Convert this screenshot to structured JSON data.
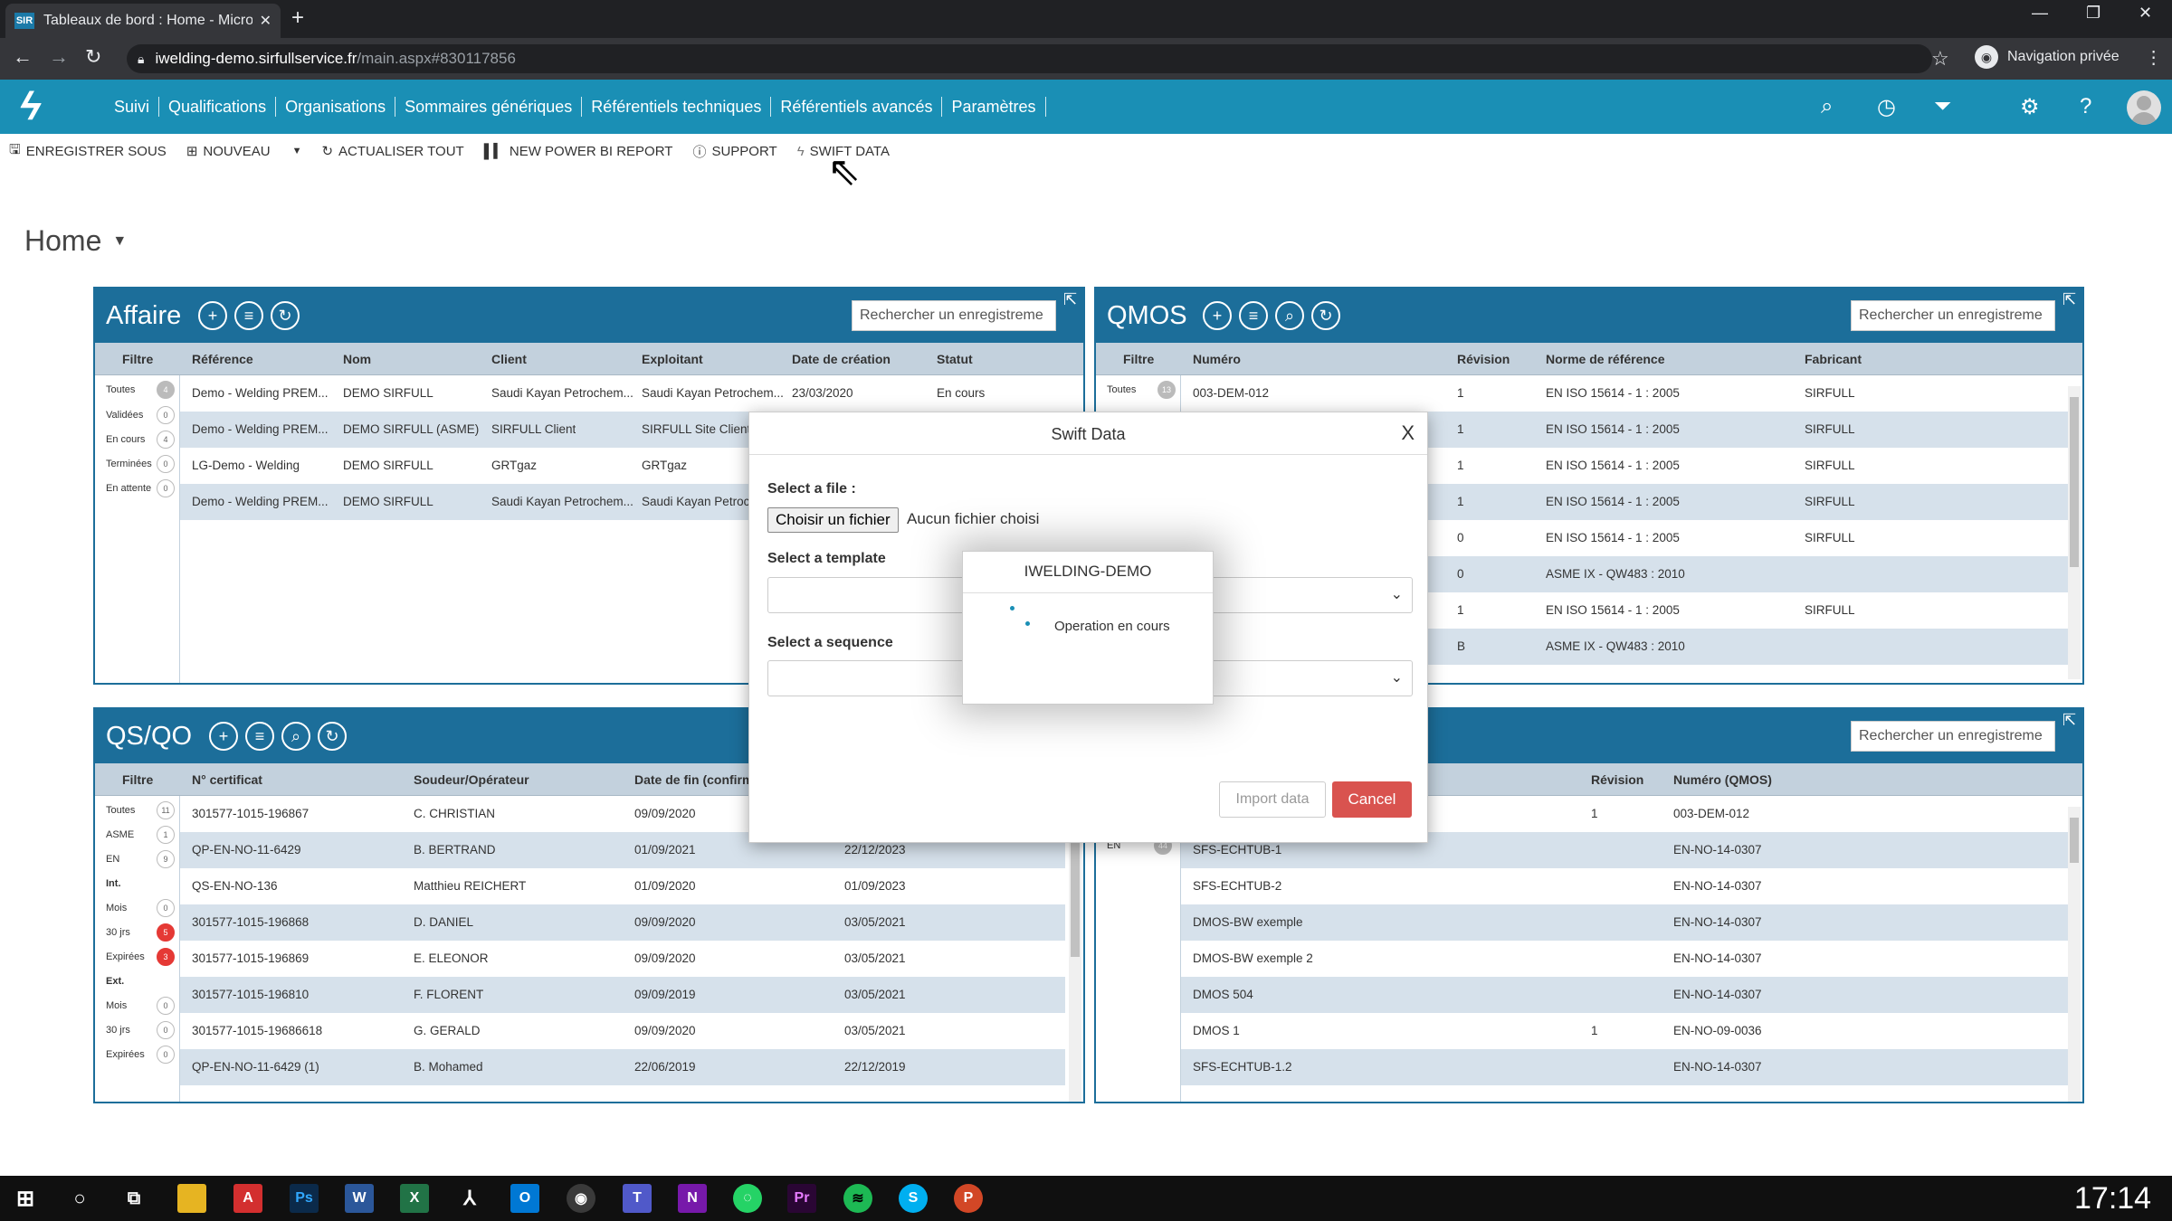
{
  "browser": {
    "tab_title": "Tableaux de bord : Home - Micro",
    "favicon_text": "SIR",
    "url_host": "iwelding-demo.sirfullservice.fr",
    "url_path": "/main.aspx#830117856",
    "private_label": "Navigation privée"
  },
  "nav": {
    "menu": [
      "Suivi",
      "Qualifications",
      "Organisations",
      "Sommaires génériques",
      "Référentiels techniques",
      "Référentiels avancés",
      "Paramètres"
    ],
    "icons": [
      "search-icon",
      "history-icon",
      "filter-icon",
      "gear-icon",
      "help-icon",
      "avatar"
    ]
  },
  "toolbar": {
    "save_as": "ENREGISTRER SOUS",
    "new": "NOUVEAU",
    "refresh_all": "ACTUALISER TOUT",
    "new_powerbi": "NEW POWER BI REPORT",
    "support": "SUPPORT",
    "swift_data": "SWIFT DATA"
  },
  "page": {
    "title": "Home"
  },
  "affaire": {
    "title": "Affaire",
    "search_placeholder": "Rechercher un enregistreme",
    "filter_header": "Filtre",
    "columns": [
      "Référence",
      "Nom",
      "Client",
      "Exploitant",
      "Date de création",
      "Statut"
    ],
    "filters": [
      {
        "label": "Toutes",
        "count": "4"
      },
      {
        "label": "Validées",
        "count": "0"
      },
      {
        "label": "En cours",
        "count": "4"
      },
      {
        "label": "Terminées",
        "count": "0"
      },
      {
        "label": "En attente",
        "count": "0"
      }
    ],
    "rows": [
      [
        "Demo - Welding PREM...",
        "DEMO SIRFULL",
        "Saudi Kayan Petrochem...",
        "Saudi Kayan Petrochem...",
        "23/03/2020",
        "En cours"
      ],
      [
        "Demo - Welding PREM...",
        "DEMO SIRFULL (ASME)",
        "SIRFULL Client",
        "SIRFULL Site Client",
        "",
        ""
      ],
      [
        "LG-Demo - Welding",
        "DEMO SIRFULL",
        "GRTgaz",
        "GRTgaz",
        "",
        ""
      ],
      [
        "Demo - Welding PREM...",
        "DEMO SIRFULL",
        "Saudi Kayan Petrochem...",
        "Saudi Kayan Petroc",
        "",
        ""
      ]
    ]
  },
  "qmos": {
    "title": "QMOS",
    "search_placeholder": "Rechercher un enregistreme",
    "filter_header": "Filtre",
    "columns": [
      "Numéro",
      "Révision",
      "Norme de référence",
      "Fabricant"
    ],
    "filters": [
      {
        "label": "Toutes",
        "count": "13"
      }
    ],
    "rows": [
      [
        "003-DEM-012",
        "1",
        "EN ISO 15614 - 1 : 2005",
        "SIRFULL"
      ],
      [
        "",
        "1",
        "EN ISO 15614 - 1 : 2005",
        "SIRFULL"
      ],
      [
        "",
        "1",
        "EN ISO 15614 - 1 : 2005",
        "SIRFULL"
      ],
      [
        "",
        "1",
        "EN ISO 15614 - 1 : 2005",
        "SIRFULL"
      ],
      [
        "",
        "0",
        "EN ISO 15614 - 1 : 2005",
        "SIRFULL"
      ],
      [
        "",
        "0",
        "ASME IX - QW483 : 2010",
        ""
      ],
      [
        "",
        "1",
        "EN ISO 15614 - 1 : 2005",
        "SIRFULL"
      ],
      [
        "",
        "B",
        "ASME IX - QW483 : 2010",
        ""
      ]
    ]
  },
  "qsqo": {
    "title": "QS/QO",
    "filter_header": "Filtre",
    "columns": [
      "N° certificat",
      "Soudeur/Opérateur",
      "Date de fin (confirm",
      ""
    ],
    "filters": [
      {
        "label": "Toutes",
        "count": "11"
      },
      {
        "label": "ASME",
        "count": "1"
      },
      {
        "label": "EN",
        "count": "9"
      },
      {
        "label": "Int.",
        "count": ""
      },
      {
        "label": "Mois",
        "count": "0"
      },
      {
        "label": "30 jrs",
        "count": "5"
      },
      {
        "label": "Expirées",
        "count": "3"
      },
      {
        "label": "Ext.",
        "count": ""
      },
      {
        "label": "Mois",
        "count": "0"
      },
      {
        "label": "30 jrs",
        "count": "0"
      },
      {
        "label": "Expirées",
        "count": "0"
      }
    ],
    "rows": [
      [
        "301577-1015-196867",
        "C. CHRISTIAN",
        "09/09/2020",
        ""
      ],
      [
        "QP-EN-NO-11-6429",
        "B. BERTRAND",
        "01/09/2021",
        "22/12/2023"
      ],
      [
        "QS-EN-NO-136",
        "Matthieu REICHERT",
        "01/09/2020",
        "01/09/2023"
      ],
      [
        "301577-1015-196868",
        "D. DANIEL",
        "09/09/2020",
        "03/05/2021"
      ],
      [
        "301577-1015-196869",
        "E. ELEONOR",
        "09/09/2020",
        "03/05/2021"
      ],
      [
        "301577-1015-196810",
        "F. FLORENT",
        "09/09/2019",
        "03/05/2021"
      ],
      [
        "301577-1015-19686618",
        "G. GERALD",
        "09/09/2020",
        "03/05/2021"
      ],
      [
        "QP-EN-NO-11-6429 (1)",
        "B. Mohamed",
        "22/06/2019",
        "22/12/2019"
      ]
    ]
  },
  "dmos": {
    "search_placeholder": "Rechercher un enregistreme",
    "columns": [
      "",
      "Révision",
      "Numéro (QMOS)"
    ],
    "filters": [
      {
        "label": "EN",
        "count": "44"
      }
    ],
    "rows": [
      [
        "",
        "1",
        "003-DEM-012"
      ],
      [
        "SFS-ECHTUB-1",
        "",
        "EN-NO-14-0307"
      ],
      [
        "SFS-ECHTUB-2",
        "",
        "EN-NO-14-0307"
      ],
      [
        "DMOS-BW exemple",
        "",
        "EN-NO-14-0307"
      ],
      [
        "DMOS-BW exemple 2",
        "",
        "EN-NO-14-0307"
      ],
      [
        "DMOS 504",
        "",
        "EN-NO-14-0307"
      ],
      [
        "DMOS 1",
        "1",
        "EN-NO-09-0036"
      ],
      [
        "SFS-ECHTUB-1.2",
        "",
        "EN-NO-14-0307"
      ]
    ]
  },
  "modal": {
    "title": "Swift Data",
    "close": "X",
    "file_label": "Select a file :",
    "file_button": "Choisir un fichier",
    "file_status": "Aucun fichier choisi",
    "template_label": "Select a template",
    "sequence_label": "Select a sequence",
    "import_button": "Import data",
    "cancel_button": "Cancel"
  },
  "loader": {
    "title": "IWELDING-DEMO",
    "text": "Operation en cours"
  },
  "taskbar": {
    "clock": "17:14"
  }
}
